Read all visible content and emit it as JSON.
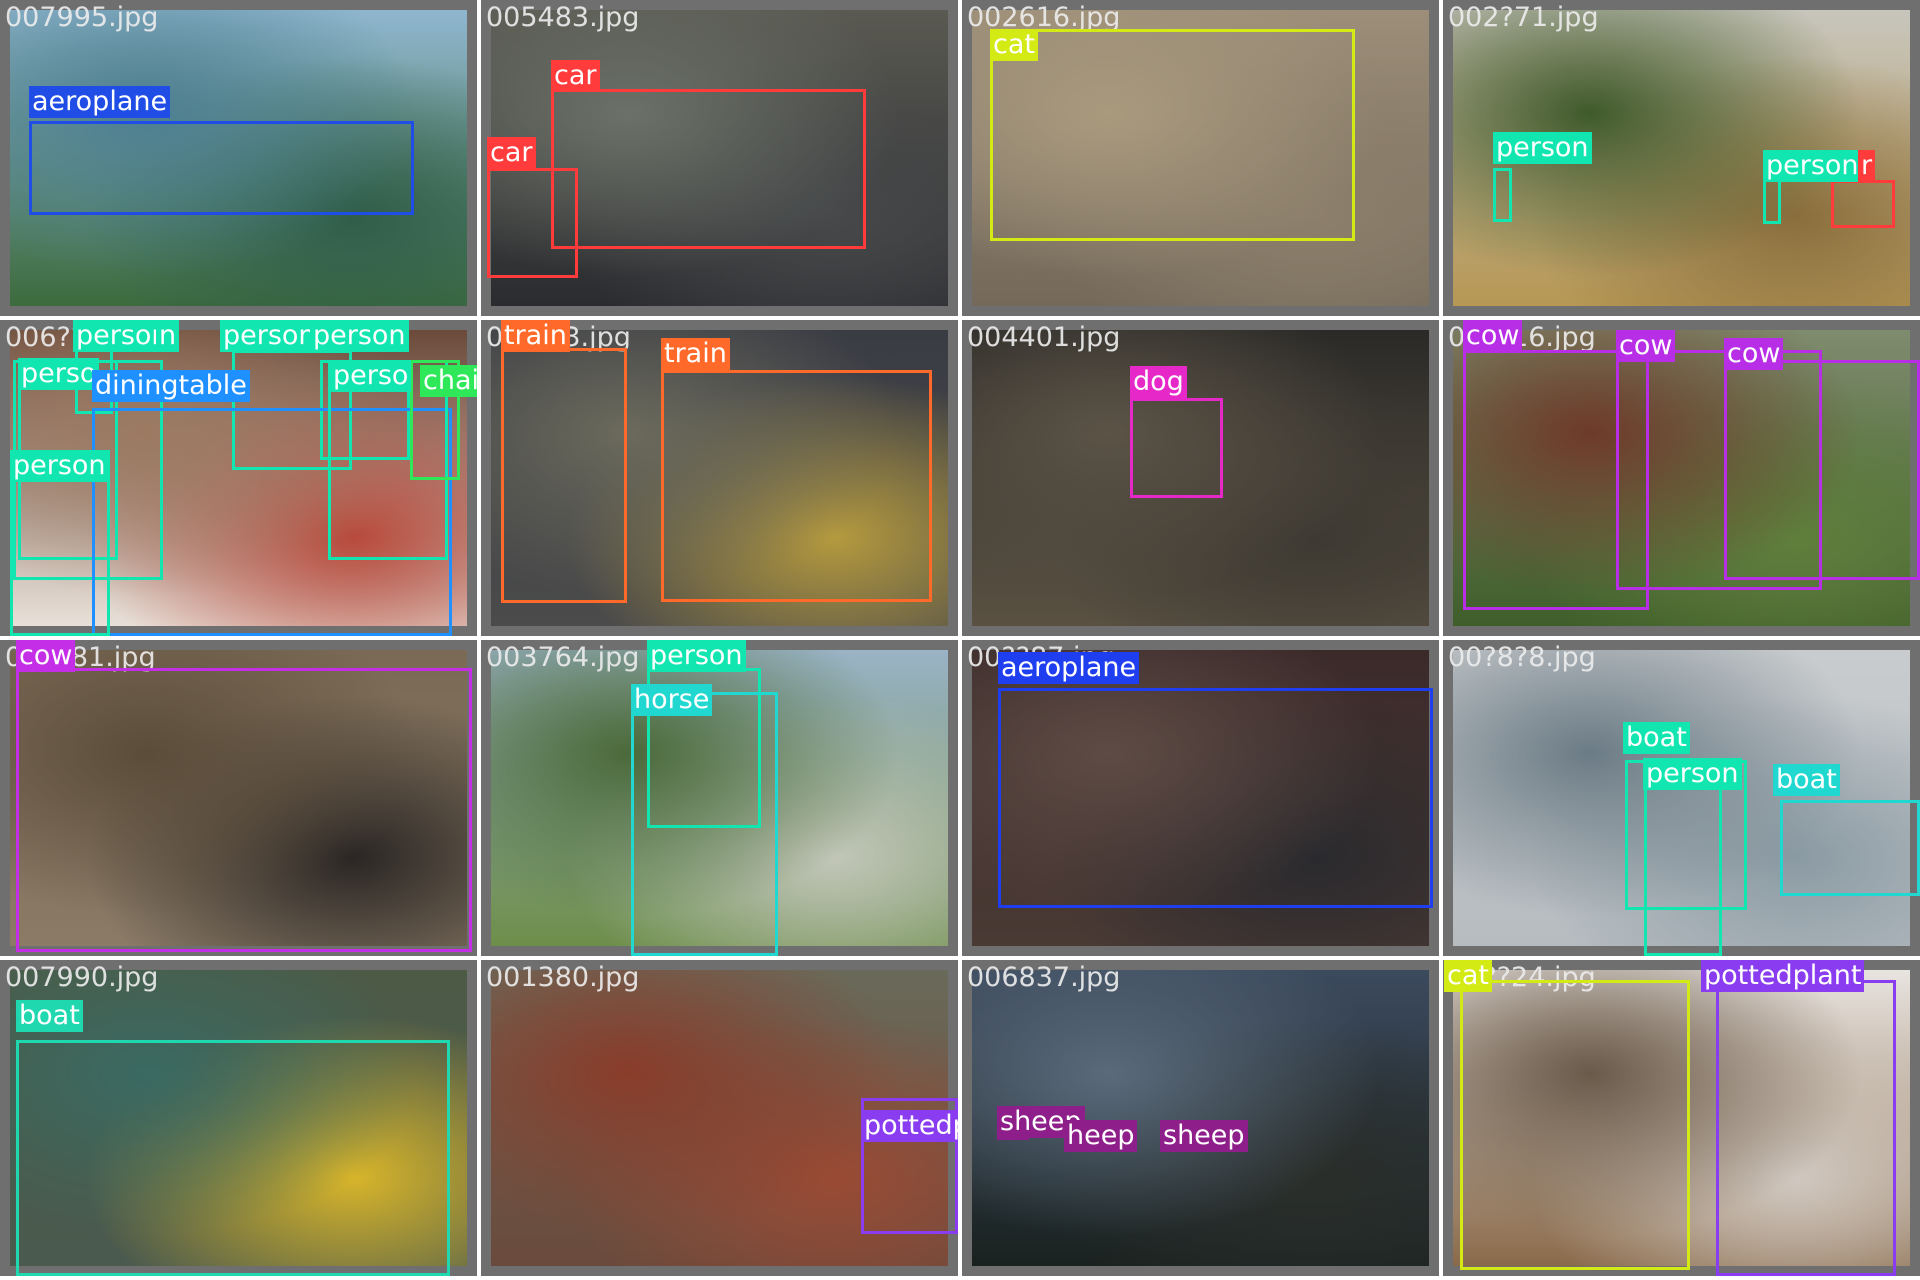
{
  "mosaic": {
    "cells": [
      {
        "filename": "007995.jpg",
        "photo": [
          "#8fb6cf",
          "#4d7f91",
          "#2f5d49",
          "#3c6b3d"
        ],
        "detections": [
          {
            "label": "aeroplane",
            "color": "#1f4de6"
          }
        ]
      },
      {
        "filename": "005483.jpg",
        "photo": [
          "#5a5a52",
          "#6b7168",
          "#46484a",
          "#2b2c30"
        ],
        "detections": [
          {
            "label": "car",
            "color": "#ff3b3b"
          },
          {
            "label": "car",
            "color": "#ff3b3b"
          }
        ]
      },
      {
        "filename": "002616.jpg",
        "photo": [
          "#9c8e78",
          "#a99a7e",
          "#8c7f6b",
          "#74695a"
        ],
        "detections": [
          {
            "label": "cat",
            "color": "#d4ea14"
          }
        ]
      },
      {
        "filename": "002?71.jpg",
        "photo": [
          "#c7c5bc",
          "#3f5a2b",
          "#8a6e3c",
          "#b69754"
        ],
        "detections": [
          {
            "label": "person",
            "color": "#12e6b0"
          },
          {
            "label": "person",
            "color": "#12e6b0"
          },
          {
            "label": "r",
            "color": "#ff3b3b"
          }
        ]
      },
      {
        "filename": "006???.jpg",
        "photo": [
          "#6b4a3a",
          "#9c7a62",
          "#b84a3c",
          "#e8e0d8"
        ],
        "detections": [
          {
            "label": "person",
            "color": "#12e6b0"
          },
          {
            "label": "n",
            "color": "#12e6b0"
          },
          {
            "label": "person",
            "color": "#12e6b0"
          },
          {
            "label": "person",
            "color": "#12e6b0"
          },
          {
            "label": "perso",
            "color": "#12e6b0"
          },
          {
            "label": "diningtable",
            "color": "#1e90ff"
          },
          {
            "label": "perso",
            "color": "#12e6b0"
          },
          {
            "label": "chair",
            "color": "#2fe85a"
          },
          {
            "label": "person",
            "color": "#12e6b0"
          }
        ]
      },
      {
        "filename": "0???63.jpg",
        "photo": [
          "#3a3c44",
          "#6b6a5c",
          "#b59a3e",
          "#4b4b4b"
        ],
        "detections": [
          {
            "label": "train",
            "color": "#ff6a2a"
          },
          {
            "label": "train",
            "color": "#ff6a2a"
          }
        ]
      },
      {
        "filename": "004401.jpg",
        "photo": [
          "#2b2a28",
          "#5b5346",
          "#3e3a33",
          "#5a5142"
        ],
        "detections": [
          {
            "label": "dog",
            "color": "#e628c8"
          }
        ]
      },
      {
        "filename": "00??16.jpg",
        "photo": [
          "#7f8c6e",
          "#6e3a2a",
          "#5f7f3c",
          "#3f5e2a"
        ],
        "detections": [
          {
            "label": "cow",
            "color": "#b82ee6"
          },
          {
            "label": "cow",
            "color": "#b82ee6"
          },
          {
            "label": "cow",
            "color": "#b82ee6"
          }
        ]
      },
      {
        "filename": "00?181.jpg",
        "photo": [
          "#7a6a55",
          "#5b4c3a",
          "#2a2624",
          "#8a7a66"
        ],
        "detections": [
          {
            "label": "cow",
            "color": "#c42ee6"
          }
        ]
      },
      {
        "filename": "003764.jpg",
        "photo": [
          "#9ab3c6",
          "#4b6a3a",
          "#c2c6b8",
          "#6d8e4a"
        ],
        "detections": [
          {
            "label": "person",
            "color": "#12e6b0"
          },
          {
            "label": "horse",
            "color": "#20d8cf"
          }
        ]
      },
      {
        "filename": "00??87.jpg",
        "photo": [
          "#3b2a2a",
          "#5e4b45",
          "#2a2a2e",
          "#4a3a34"
        ],
        "detections": [
          {
            "label": "aeroplane",
            "color": "#1f3ef0"
          }
        ]
      },
      {
        "filename": "00?8?8.jpg",
        "photo": [
          "#c9ccce",
          "#6b7b85",
          "#8a9aa3",
          "#b6bcc0"
        ],
        "detections": [
          {
            "label": "boat",
            "color": "#12e6b0"
          },
          {
            "label": "person",
            "color": "#12e6b0"
          },
          {
            "label": "boat",
            "color": "#20d8cf"
          }
        ]
      },
      {
        "filename": "007990.jpg",
        "photo": [
          "#4d5a46",
          "#3a6a62",
          "#d8b52a",
          "#4a5a4e"
        ],
        "detections": [
          {
            "label": "boat",
            "color": "#20d8b0"
          }
        ]
      },
      {
        "filename": "001380.jpg",
        "photo": [
          "#6a6a5a",
          "#8a3c2a",
          "#9a4a34",
          "#6a4a3c"
        ],
        "detections": [
          {
            "label": "pottedplar",
            "color": "#8a3cf0"
          }
        ]
      },
      {
        "filename": "006837.jpg",
        "photo": [
          "#3c4a5e",
          "#5a6a7a",
          "#2a2e2a",
          "#1a2220"
        ],
        "detections": [
          {
            "label": "sheep",
            "color": "#8e1e8a"
          },
          {
            "label": "heep",
            "color": "#8e1e8a"
          },
          {
            "label": "sheep",
            "color": "#8e1e8a"
          }
        ]
      },
      {
        "filename": "00??24.jpg",
        "photo": [
          "#e8e4e0",
          "#6a5a4a",
          "#d0c8c0",
          "#8a6a4a"
        ],
        "detections": [
          {
            "label": "cat",
            "color": "#d4ea14"
          },
          {
            "label": "pottedplant",
            "color": "#8a3cf0"
          }
        ]
      }
    ]
  }
}
